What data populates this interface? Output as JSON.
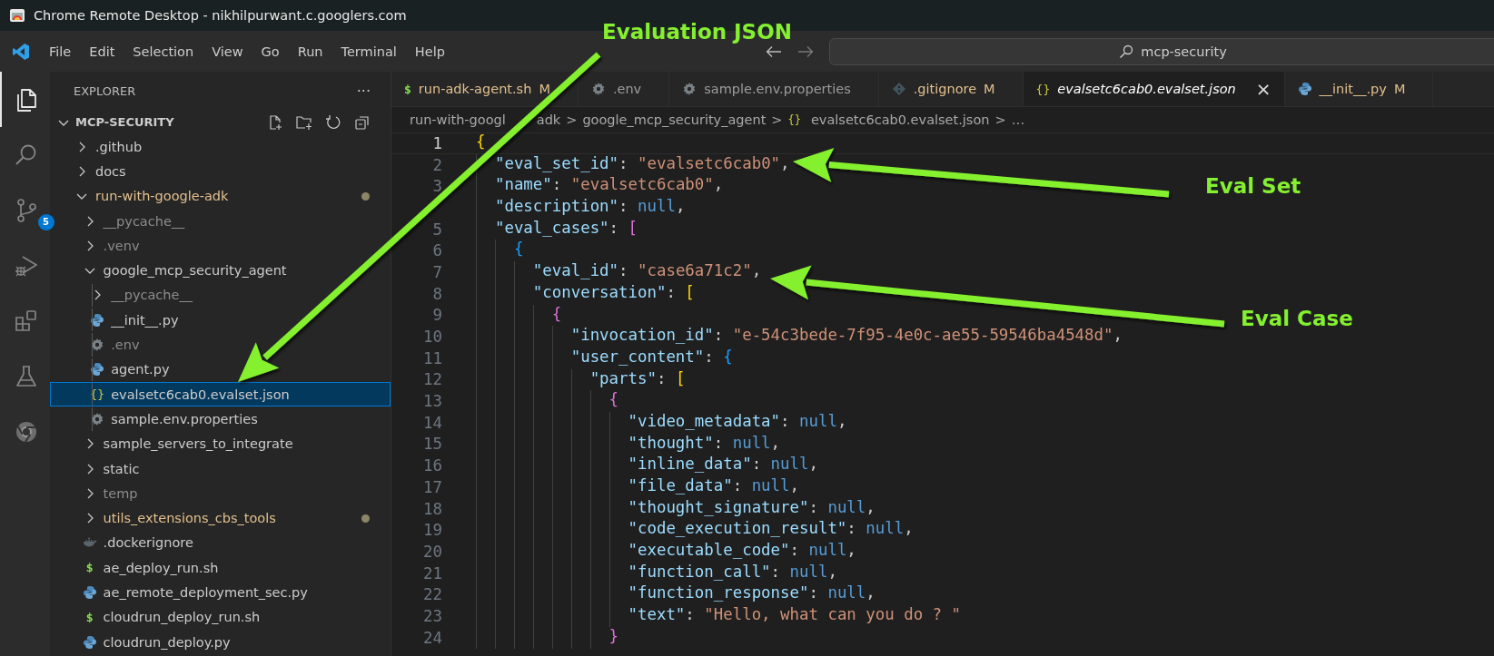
{
  "window": {
    "title": "Chrome Remote Desktop - nikhilpurwant.c.googlers.com"
  },
  "menu": [
    "File",
    "Edit",
    "Selection",
    "View",
    "Go",
    "Run",
    "Terminal",
    "Help"
  ],
  "command_center": {
    "value": "mcp-security"
  },
  "activity_bar": [
    {
      "kind": "explorer",
      "selected": true
    },
    {
      "kind": "search",
      "selected": false
    },
    {
      "kind": "source-control",
      "selected": false,
      "badge": "5"
    },
    {
      "kind": "run-debug",
      "selected": false
    },
    {
      "kind": "extensions",
      "selected": false
    },
    {
      "kind": "testing",
      "selected": false
    },
    {
      "kind": "chrome",
      "selected": false
    }
  ],
  "sidebar": {
    "title": "EXPLORER",
    "more": "···",
    "root": {
      "label": "MCP-SECURITY",
      "expanded": true
    },
    "tree": [
      {
        "name": ".github",
        "kind": "folder",
        "expanded": false,
        "selected": false,
        "modified": false,
        "ignored": false
      },
      {
        "name": "docs",
        "kind": "folder",
        "expanded": false,
        "selected": false,
        "modified": false,
        "ignored": false
      },
      {
        "name": "run-with-google-adk",
        "kind": "folder",
        "expanded": true,
        "selected": false,
        "modified": true,
        "ignored": false,
        "children": [
          {
            "name": "__pycache__",
            "kind": "folder",
            "expanded": false,
            "selected": false,
            "modified": false,
            "ignored": true
          },
          {
            "name": ".venv",
            "kind": "folder",
            "expanded": false,
            "selected": false,
            "modified": false,
            "ignored": true
          },
          {
            "name": "google_mcp_security_agent",
            "kind": "folder",
            "expanded": true,
            "selected": false,
            "modified": false,
            "ignored": false,
            "children": [
              {
                "name": "__pycache__",
                "kind": "folder",
                "expanded": false,
                "selected": false,
                "modified": false,
                "ignored": true
              },
              {
                "name": "__init__.py",
                "kind": "python",
                "selected": false,
                "modified": false,
                "ignored": false
              },
              {
                "name": ".env",
                "kind": "gear",
                "selected": false,
                "modified": false,
                "ignored": true
              },
              {
                "name": "agent.py",
                "kind": "python",
                "selected": false,
                "modified": false,
                "ignored": false
              },
              {
                "name": "evalsetc6cab0.evalset.json",
                "kind": "json",
                "glyph": "{}",
                "selected": true,
                "modified": false,
                "ignored": false
              },
              {
                "name": "sample.env.properties",
                "kind": "gear",
                "selected": false,
                "modified": false,
                "ignored": false
              }
            ]
          },
          {
            "name": "sample_servers_to_integrate",
            "kind": "folder",
            "expanded": false,
            "selected": false,
            "modified": false,
            "ignored": false
          },
          {
            "name": "static",
            "kind": "folder",
            "expanded": false,
            "selected": false,
            "modified": false,
            "ignored": false
          },
          {
            "name": "temp",
            "kind": "folder",
            "expanded": false,
            "selected": false,
            "modified": false,
            "ignored": true
          },
          {
            "name": "utils_extensions_cbs_tools",
            "kind": "folder",
            "expanded": false,
            "selected": false,
            "modified": true,
            "ignored": false
          },
          {
            "name": ".dockerignore",
            "kind": "docker",
            "selected": false,
            "modified": false,
            "ignored": false
          },
          {
            "name": "ae_deploy_run.sh",
            "kind": "shell",
            "glyph": "$",
            "selected": false,
            "modified": false,
            "ignored": false
          },
          {
            "name": "ae_remote_deployment_sec.py",
            "kind": "python",
            "selected": false,
            "modified": false,
            "ignored": false
          },
          {
            "name": "cloudrun_deploy_run.sh",
            "kind": "shell",
            "glyph": "$",
            "selected": false,
            "modified": false,
            "ignored": false
          },
          {
            "name": "cloudrun_deploy.py",
            "kind": "python",
            "selected": false,
            "modified": false,
            "ignored": false
          }
        ]
      }
    ]
  },
  "tabs": [
    {
      "label": "run-adk-agent.sh",
      "kind": "shell",
      "glyph": "$",
      "badge": "M",
      "selected": false,
      "preview": false
    },
    {
      "label": ".env",
      "kind": "gear",
      "selected": false,
      "preview": false
    },
    {
      "label": "sample.env.properties",
      "kind": "gear",
      "selected": false,
      "preview": false
    },
    {
      "label": ".gitignore",
      "kind": "git",
      "badge": "M",
      "selected": false,
      "preview": false
    },
    {
      "label": "evalsetc6cab0.evalset.json",
      "kind": "json",
      "glyph": "{}",
      "close": "×",
      "selected": true,
      "preview": true
    },
    {
      "label": "__init__.py",
      "kind": "python",
      "badge": "M",
      "selected": false,
      "preview": false
    }
  ],
  "breadcrumb": [
    {
      "parts": [
        "run-with-googl",
        "adk"
      ]
    },
    {
      "text": "google_mcp_security_agent"
    },
    {
      "text": "evalsetc6cab0.evalset.json",
      "glyph": "{}"
    },
    {
      "text": "…"
    }
  ],
  "breadcrumb_separator": ">",
  "code": [
    {
      "number": "1",
      "active": true,
      "tokens": [
        {
          "kind": "bracket",
          "text": "{",
          "color": "#ffd700"
        }
      ]
    },
    {
      "number": "2",
      "active": false,
      "tokens": [
        {
          "kind": "key",
          "text": "  \"eval_set_id\""
        },
        {
          "kind": "punct",
          "text": ": "
        },
        {
          "kind": "string",
          "text": "\"evalsetc6cab0\""
        },
        {
          "kind": "punct",
          "text": ","
        }
      ]
    },
    {
      "number": "3",
      "active": false,
      "tokens": [
        {
          "kind": "key",
          "text": "  \"name\""
        },
        {
          "kind": "punct",
          "text": ": "
        },
        {
          "kind": "string",
          "text": "\"evalsetc6cab0\""
        },
        {
          "kind": "punct",
          "text": ","
        }
      ]
    },
    {
      "active": false,
      "tokens": [
        {
          "kind": "key",
          "text": "  \"description\""
        },
        {
          "kind": "punct",
          "text": ": "
        },
        {
          "kind": "null",
          "text": "null"
        },
        {
          "kind": "punct",
          "text": ","
        }
      ]
    },
    {
      "number": "5",
      "active": false,
      "tokens": [
        {
          "kind": "key",
          "text": "  \"eval_cases\""
        },
        {
          "kind": "punct",
          "text": ": "
        },
        {
          "kind": "bracket",
          "text": "[",
          "color": "#da70d6"
        }
      ]
    },
    {
      "number": "6",
      "active": false,
      "tokens": [
        {
          "kind": "bracket",
          "text": "    {",
          "color": "#179fff"
        }
      ]
    },
    {
      "number": "7",
      "active": false,
      "tokens": [
        {
          "kind": "key",
          "text": "      \"eval_id\""
        },
        {
          "kind": "punct",
          "text": ": "
        },
        {
          "kind": "string",
          "text": "\"case6a71c2\""
        },
        {
          "kind": "punct",
          "text": ","
        }
      ]
    },
    {
      "number": "8",
      "active": false,
      "tokens": [
        {
          "kind": "key",
          "text": "      \"conversation\""
        },
        {
          "kind": "punct",
          "text": ": "
        },
        {
          "kind": "bracket",
          "text": "[",
          "color": "#ffd700"
        }
      ]
    },
    {
      "number": "9",
      "active": false,
      "tokens": [
        {
          "kind": "bracket",
          "text": "        {",
          "color": "#da70d6"
        }
      ]
    },
    {
      "number": "10",
      "active": false,
      "tokens": [
        {
          "kind": "key",
          "text": "          \"invocation_id\""
        },
        {
          "kind": "punct",
          "text": ": "
        },
        {
          "kind": "string",
          "text": "\"e-54c3bede-7f95-4e0c-ae55-59546ba4548d\""
        },
        {
          "kind": "punct",
          "text": ","
        }
      ]
    },
    {
      "number": "11",
      "active": false,
      "tokens": [
        {
          "kind": "key",
          "text": "          \"user_content\""
        },
        {
          "kind": "punct",
          "text": ": "
        },
        {
          "kind": "bracket",
          "text": "{",
          "color": "#179fff"
        }
      ]
    },
    {
      "number": "12",
      "active": false,
      "tokens": [
        {
          "kind": "key",
          "text": "            \"parts\""
        },
        {
          "kind": "punct",
          "text": ": "
        },
        {
          "kind": "bracket",
          "text": "[",
          "color": "#ffd700"
        }
      ]
    },
    {
      "number": "13",
      "active": false,
      "tokens": [
        {
          "kind": "bracket",
          "text": "              {",
          "color": "#da70d6"
        }
      ]
    },
    {
      "number": "14",
      "active": false,
      "tokens": [
        {
          "kind": "key",
          "text": "                \"video_metadata\""
        },
        {
          "kind": "punct",
          "text": ": "
        },
        {
          "kind": "null",
          "text": "null"
        },
        {
          "kind": "punct",
          "text": ","
        }
      ]
    },
    {
      "number": "15",
      "active": false,
      "tokens": [
        {
          "kind": "key",
          "text": "                \"thought\""
        },
        {
          "kind": "punct",
          "text": ": "
        },
        {
          "kind": "null",
          "text": "null"
        },
        {
          "kind": "punct",
          "text": ","
        }
      ]
    },
    {
      "number": "16",
      "active": false,
      "tokens": [
        {
          "kind": "key",
          "text": "                \"inline_data\""
        },
        {
          "kind": "punct",
          "text": ": "
        },
        {
          "kind": "null",
          "text": "null"
        },
        {
          "kind": "punct",
          "text": ","
        }
      ]
    },
    {
      "number": "17",
      "active": false,
      "tokens": [
        {
          "kind": "key",
          "text": "                \"file_data\""
        },
        {
          "kind": "punct",
          "text": ": "
        },
        {
          "kind": "null",
          "text": "null"
        },
        {
          "kind": "punct",
          "text": ","
        }
      ]
    },
    {
      "number": "18",
      "active": false,
      "tokens": [
        {
          "kind": "key",
          "text": "                \"thought_signature\""
        },
        {
          "kind": "punct",
          "text": ": "
        },
        {
          "kind": "null",
          "text": "null"
        },
        {
          "kind": "punct",
          "text": ","
        }
      ]
    },
    {
      "number": "19",
      "active": false,
      "tokens": [
        {
          "kind": "key",
          "text": "                \"code_execution_result\""
        },
        {
          "kind": "punct",
          "text": ": "
        },
        {
          "kind": "null",
          "text": "null"
        },
        {
          "kind": "punct",
          "text": ","
        }
      ]
    },
    {
      "number": "20",
      "active": false,
      "tokens": [
        {
          "kind": "key",
          "text": "                \"executable_code\""
        },
        {
          "kind": "punct",
          "text": ": "
        },
        {
          "kind": "null",
          "text": "null"
        },
        {
          "kind": "punct",
          "text": ","
        }
      ]
    },
    {
      "number": "21",
      "active": false,
      "tokens": [
        {
          "kind": "key",
          "text": "                \"function_call\""
        },
        {
          "kind": "punct",
          "text": ": "
        },
        {
          "kind": "null",
          "text": "null"
        },
        {
          "kind": "punct",
          "text": ","
        }
      ]
    },
    {
      "number": "22",
      "active": false,
      "tokens": [
        {
          "kind": "key",
          "text": "                \"function_response\""
        },
        {
          "kind": "punct",
          "text": ": "
        },
        {
          "kind": "null",
          "text": "null"
        },
        {
          "kind": "punct",
          "text": ","
        }
      ]
    },
    {
      "number": "23",
      "active": false,
      "tokens": [
        {
          "kind": "key",
          "text": "                \"text\""
        },
        {
          "kind": "punct",
          "text": ": "
        },
        {
          "kind": "string",
          "text": "\"Hello, what can you do ? \""
        }
      ]
    },
    {
      "number": "24",
      "active": false,
      "tokens": [
        {
          "kind": "bracket",
          "text": "              }",
          "color": "#da70d6"
        }
      ]
    }
  ],
  "annotations": [
    {
      "label": "Evaluation JSON"
    },
    {
      "label": "Eval Set"
    },
    {
      "label": "Eval Case"
    }
  ]
}
